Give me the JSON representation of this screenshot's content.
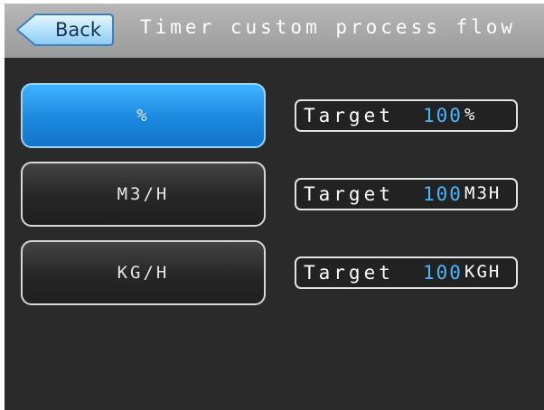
{
  "header": {
    "back_label": "Back",
    "title": "Timer custom process flow"
  },
  "modes": [
    {
      "label": "%",
      "selected": true
    },
    {
      "label": "M3/H",
      "selected": false
    },
    {
      "label": "KG/H",
      "selected": false
    }
  ],
  "targets": [
    {
      "label": "Target",
      "value": "100",
      "unit": "%"
    },
    {
      "label": "Target",
      "value": "100",
      "unit": "M3H"
    },
    {
      "label": "Target",
      "value": "100",
      "unit": "KGH"
    }
  ],
  "colors": {
    "header_bg": "#a8a8a8",
    "screen_bg": "#2a2a2a",
    "selected_button": "#2a9cf0",
    "value_text": "#4ab4ff"
  }
}
